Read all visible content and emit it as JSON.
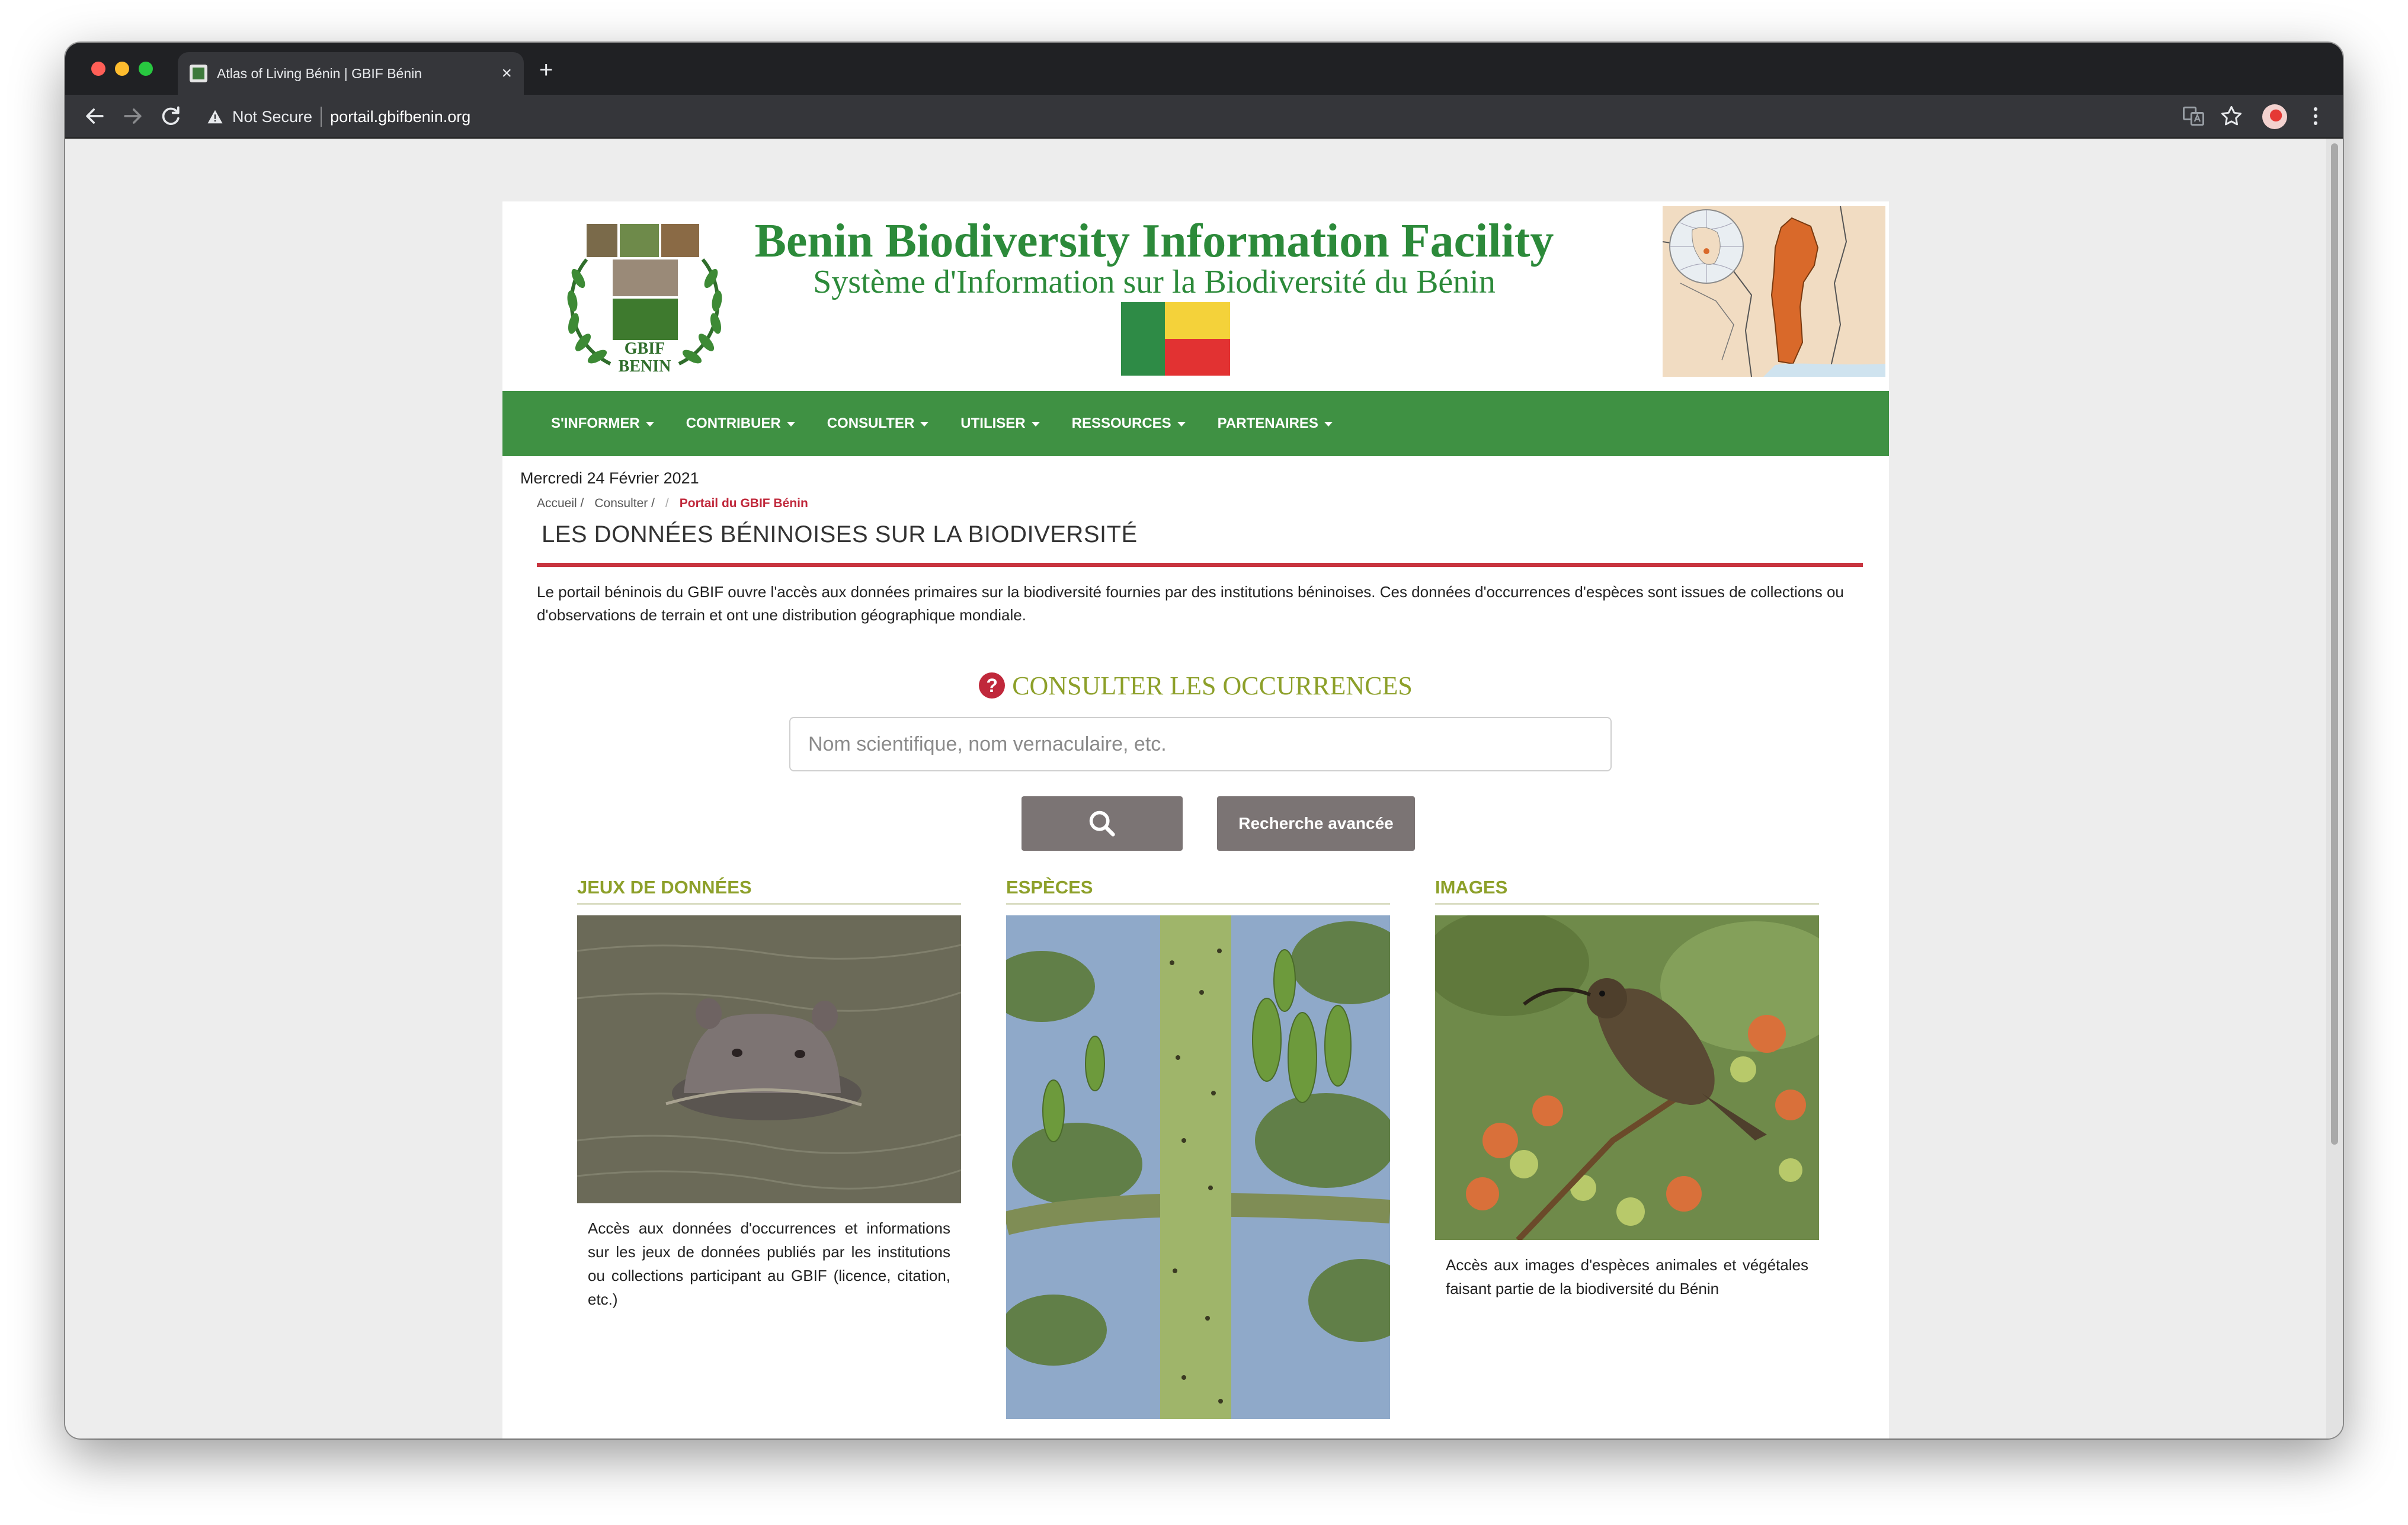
{
  "browser": {
    "tab_title": "Atlas of Living Bénin | GBIF Bénin",
    "tab_close": "×",
    "new_tab": "+",
    "security_label": "Not Secure",
    "url": "portail.gbifbenin.org"
  },
  "header": {
    "logo_line1": "GBIF",
    "logo_line2": "BENIN",
    "title": "Benin Biodiversity Information Facility",
    "subtitle": "Système d'Information sur la Biodiversité du Bénin",
    "flag_colors": [
      "#2e8b46",
      "#f4d23a",
      "#e23232"
    ]
  },
  "nav": {
    "items": [
      {
        "label": "S'INFORMER"
      },
      {
        "label": "CONTRIBUER"
      },
      {
        "label": "CONSULTER"
      },
      {
        "label": "UTILISER"
      },
      {
        "label": "RESSOURCES"
      },
      {
        "label": "PARTENAIRES"
      }
    ]
  },
  "content": {
    "date": "Mercredi 24 Février 2021",
    "breadcrumb": {
      "home": "Accueil /",
      "parent": "Consulter /",
      "sep": "/",
      "current": "Portail du GBIF Bénin"
    },
    "title": "LES DONNÉES BÉNINOISES SUR LA BIODIVERSITÉ",
    "intro": "Le portail béninois du GBIF ouvre l'accès aux données primaires sur la biodiversité fournies par des institutions béninoises. Ces données d'occurrences d'espèces sont issues de collections ou d'observations de terrain et ont une distribution géographique mondiale.",
    "occurrences_heading": "CONSULTER LES OCCURRENCES",
    "help_icon_glyph": "?",
    "search": {
      "placeholder": "Nom scientifique, nom vernaculaire, etc.",
      "value": ""
    },
    "advanced_search_label": "Recherche avancée"
  },
  "columns": [
    {
      "title": "JEUX DE DONNÉES",
      "text": "Accès aux données d'occurrences et informations sur les jeux de données publiés par les institutions ou collections participant au GBIF (licence, citation, etc.)"
    },
    {
      "title": "ESPÈCES",
      "text": ""
    },
    {
      "title": "IMAGES",
      "text": "Accès aux images d'espèces animales et végétales faisant partie de la biodiversité du Bénin"
    }
  ],
  "colors": {
    "nav_green": "#3f9143",
    "title_green": "#2c8a3a",
    "accent_red": "#c8343f",
    "olive": "#8da02a",
    "button_gray": "#7b7474"
  }
}
